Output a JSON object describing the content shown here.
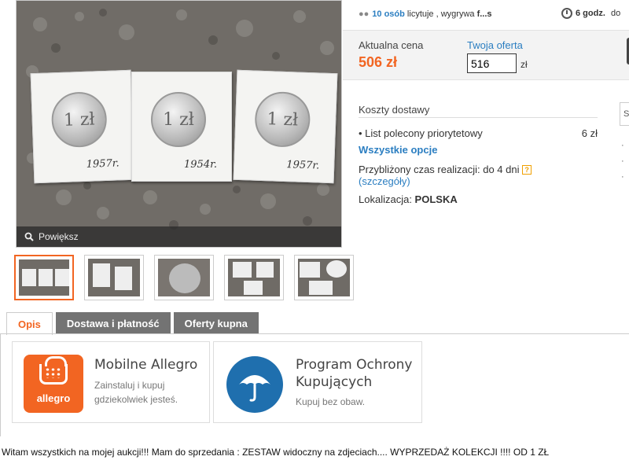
{
  "gallery": {
    "zoom_label": "Powiększ",
    "coin_face": "1 zł",
    "coin_years": [
      "1957r.",
      "1954r.",
      "1957r."
    ]
  },
  "auction": {
    "bidders_count": "10 osób",
    "bidders_text": " licytuje , wygrywa ",
    "leader": "f...s",
    "time_left": "6 godz.",
    "time_suffix": " do"
  },
  "price": {
    "current_label": "Aktualna cena",
    "current_value": "506 zł",
    "offer_label": "Twoja oferta",
    "offer_value": "516",
    "offer_unit": "zł"
  },
  "shipping": {
    "title": "Koszty dostawy",
    "option_name": "• List polecony priorytetowy",
    "option_price": "6 zł",
    "all_options": "Wszystkie opcje",
    "time_label": "Przybliżony czas realizacji: ",
    "time_value": "do 4 dni",
    "details_link": "(szczegóły)",
    "location_label": "Lokalizacja: ",
    "location_value": "POLSKA",
    "help_glyph": "?"
  },
  "tabs": [
    "Opis",
    "Dostawa i płatność",
    "Oferty kupna"
  ],
  "promos": [
    {
      "title": "Mobilne Allegro",
      "subtitle_line1": "Zainstaluj i kupuj",
      "subtitle_line2": "gdziekolwiek jesteś.",
      "logo_text": "allegro"
    },
    {
      "title_line1": "Program Ochrony",
      "title_line2": "Kupujących",
      "subtitle": "Kupuj bez obaw."
    }
  ],
  "description": "Witam wszystkich na mojej aukcji!!! Mam do sprzedania : ZESTAW widoczny na zdjeciach.... WYPRZEDAŻ KOLEKCJI !!!! OD 1 ZŁ",
  "side": {
    "frag": "S",
    "bullets": [
      "·",
      "·",
      "·"
    ]
  },
  "colors": {
    "accent": "#f26522",
    "link": "#2b7ec1",
    "tab_inactive": "#737373",
    "protection_blue": "#1f6fae"
  }
}
